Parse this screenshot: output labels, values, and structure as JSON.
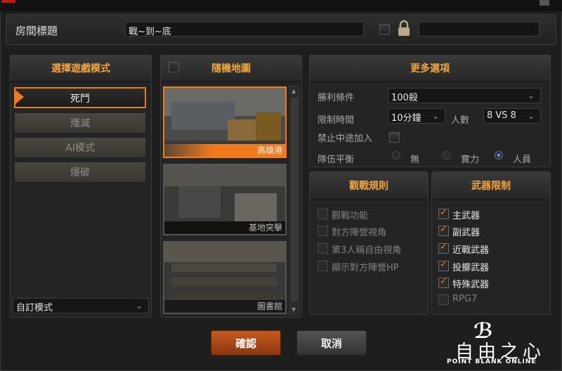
{
  "header": {
    "room_title_label": "房間標題",
    "room_title_value": "戰~到~底"
  },
  "mode_panel": {
    "title": "選擇遊戲模式",
    "modes": [
      "死鬥",
      "殲滅",
      "AI模式",
      "爆破"
    ],
    "selected_index": 0,
    "custom_mode": "自訂模式"
  },
  "map_panel": {
    "title": "隨機地圖",
    "maps": [
      "高雄港",
      "基地突擊",
      "圖書館"
    ],
    "selected_index": 0
  },
  "options_panel": {
    "title": "更多選項",
    "win_condition_label": "勝利條件",
    "win_condition_value": "100殺",
    "time_limit_label": "限制時間",
    "time_limit_value": "10分鐘",
    "players_label": "人數",
    "players_value": "8 VS 8",
    "no_join_label": "禁止中途加入",
    "team_balance_label": "隊伍平衡",
    "balance_options": [
      "無",
      "實力",
      "人員"
    ],
    "balance_selected": 2
  },
  "observer_panel": {
    "title": "觀戰規則",
    "items": [
      "觀戰功能",
      "對方陣營視角",
      "第3人稱自由視角",
      "顯示對方陣營HP"
    ]
  },
  "weapon_panel": {
    "title": "武器限制",
    "items": [
      "主武器",
      "副武器",
      "近戰武器",
      "投擲武器",
      "特殊武器",
      "RPG7"
    ],
    "checked": [
      true,
      true,
      true,
      true,
      true,
      false
    ]
  },
  "buttons": {
    "confirm": "確認",
    "cancel": "取消"
  },
  "logo": {
    "text": "自由之心",
    "sub": "POINT BLANK ONLINE"
  },
  "colors": {
    "accent": "#f07b1e",
    "header_text": "#f0a540"
  }
}
